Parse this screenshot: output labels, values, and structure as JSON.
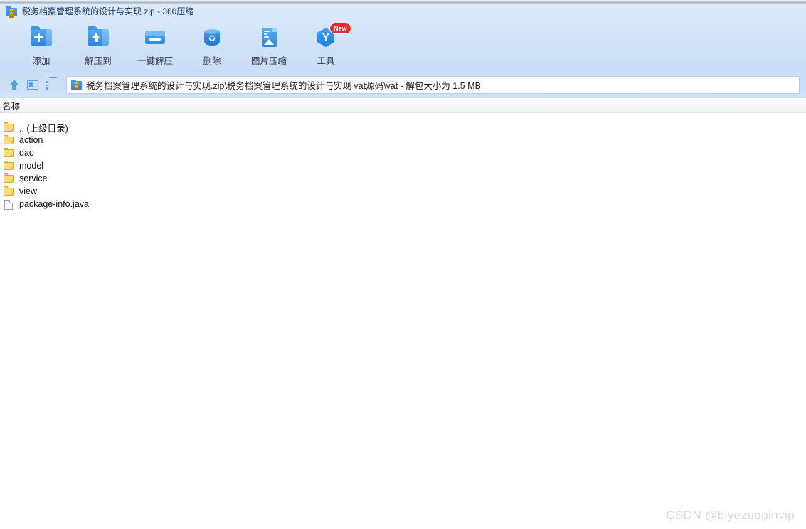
{
  "window": {
    "title": "税务档案管理系统的设计与实现.zip - 360压缩",
    "app_icon": "zip-folder-icon"
  },
  "toolbar": {
    "buttons": [
      {
        "label": "添加",
        "icon": "folder-add-icon",
        "badge": null
      },
      {
        "label": "解压到",
        "icon": "folder-extract-to-icon",
        "badge": null
      },
      {
        "label": "一键解压",
        "icon": "one-click-extract-icon",
        "badge": null
      },
      {
        "label": "删除",
        "icon": "recycle-bin-icon",
        "badge": null
      },
      {
        "label": "图片压缩",
        "icon": "image-compress-icon",
        "badge": null
      },
      {
        "label": "工具",
        "icon": "tools-hex-icon",
        "badge": "New"
      }
    ]
  },
  "navbar": {
    "up_icon": "up-arrow-icon",
    "preview_icon": "preview-panel-icon",
    "list_icon": "list-view-icon",
    "address": {
      "icon": "zip-folder-icon",
      "value": "税务档案管理系统的设计与实现.zip\\税务档案管理系统的设计与实现 vat源码\\vat - 解包大小为 1.5 MB",
      "placeholder": "请输入路径"
    }
  },
  "columns": [
    {
      "key": "name",
      "label": "名称"
    }
  ],
  "files": [
    {
      "name": ".. (上级目录)",
      "type": "folder"
    },
    {
      "name": "action",
      "type": "folder"
    },
    {
      "name": "dao",
      "type": "folder"
    },
    {
      "name": "model",
      "type": "folder"
    },
    {
      "name": "service",
      "type": "folder"
    },
    {
      "name": "view",
      "type": "folder"
    },
    {
      "name": "package-info.java",
      "type": "file"
    }
  ],
  "watermark": {
    "text": "CSDN @biyezuopinvip"
  },
  "colors": {
    "titlebar_bg": "#dbeafb",
    "toolbar_bg": "#cfe1f7",
    "navbar_bg": "#c9ddf6",
    "accent_blue": "#2d88e1",
    "folder_yellow": "#ffdc73",
    "badge_red": "#ec2b2b",
    "list_bg": "#ffffff",
    "header_bg": "#f1f4f7",
    "watermark_gray": "#d8d8d8"
  }
}
